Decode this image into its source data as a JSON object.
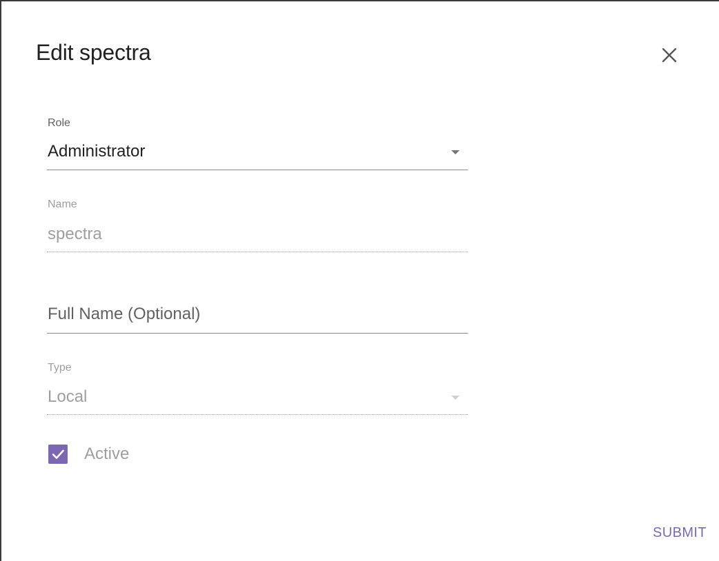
{
  "dialog": {
    "title": "Edit spectra",
    "close_icon": "close-icon"
  },
  "fields": {
    "role": {
      "label": "Role",
      "value": "Administrator",
      "icon": "caret-down-icon"
    },
    "name": {
      "label": "Name",
      "value": "spectra",
      "disabled": true
    },
    "full_name": {
      "placeholder": "Full Name (Optional)",
      "value": ""
    },
    "type": {
      "label": "Type",
      "value": "Local",
      "disabled": true,
      "icon": "caret-down-icon"
    }
  },
  "active": {
    "label": "Active",
    "checked": true,
    "icon": "check-icon"
  },
  "actions": {
    "submit_label": "SUBMIT"
  },
  "colors": {
    "accent": "#7c68b2",
    "text": "#212121",
    "muted": "#9e9e9e"
  }
}
